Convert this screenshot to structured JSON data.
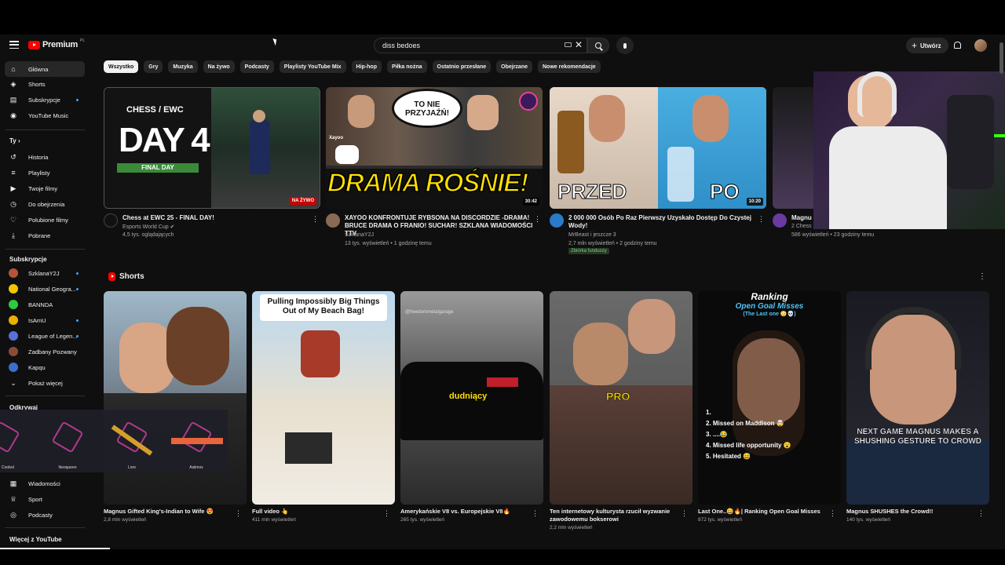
{
  "header": {
    "logo": "Premium",
    "logo_region": "PL",
    "search_value": "diss bedoes",
    "create_label": "Utwórz"
  },
  "sidebar": {
    "main": [
      "Główna",
      "Shorts",
      "Subskrypcje",
      "YouTube Music"
    ],
    "you_heading": "Ty",
    "you_items": [
      "Historia",
      "Playlisty",
      "Twoje filmy",
      "Do obejrzenia",
      "Polubione filmy",
      "Pobrane"
    ],
    "subs_heading": "Subskrypcje",
    "subs": [
      "SzklanaY2J",
      "National Geogra...",
      "BANNDA",
      "IsAmU",
      "League of Legen...",
      "Zadbany Pozwany",
      "Kapqu"
    ],
    "show_more": "Pokaż więcej",
    "explore_heading": "Odkrywaj",
    "explore_items": [
      "Wiadomości",
      "Sport",
      "Podcasty"
    ],
    "more_heading": "Więcej z YouTube"
  },
  "chips": [
    "Wszystko",
    "Gry",
    "Muzyka",
    "Na żywo",
    "Podcasty",
    "Playlisty YouTube Mix",
    "Hip-hop",
    "Piłka nożna",
    "Ostatnio przesłane",
    "Obejrzane",
    "Nowe rekomendacje"
  ],
  "videos": [
    {
      "title": "Chess at EWC 25 - FINAL DAY!",
      "title2": "",
      "channel": "Esports World Cup ✔",
      "stats": "4,5 tys. oglądających",
      "badge": "NA ŻYWO",
      "thumb_text1": "CHESS / EWC",
      "thumb_text2": "DAY 4",
      "thumb_text3": "FINAL DAY"
    },
    {
      "title": "XAYOO KONFRONTUJE RYBSONA NA DISCORDZIE -DRAMA!",
      "title2": "BRUCE DRAMA O FRANIO! SUCHAR! SZKLANA WIADOMOŚCI TTV",
      "channel": "SzklanaY2J",
      "stats": "13 tys. wyświetleń • 1 godzinę temu",
      "badge": "30:42",
      "thumb_text1": "TO NIE PRZYJAŹŃ!",
      "thumb_text2": "DRAMA ROŚNIE!",
      "thumb_text3": "Xayoo"
    },
    {
      "title": "2 000 000 Osób Po Raz Pierwszy Uzyskało Dostęp Do Czystej",
      "title2": "Wody!",
      "channel": "MrBeast i jeszcze 3",
      "stats": "2,7 mln wyświetleń • 2 godziny temu",
      "badge": "10:20",
      "funded": "Zbiórka funduszy",
      "thumb_text1": "PRZED",
      "thumb_text2": "PO"
    },
    {
      "title": "Magnu",
      "channel": "2 Chess",
      "stats": "586 wyświetleń • 23 godziny temu"
    }
  ],
  "shorts": {
    "heading": "Shorts",
    "items": [
      {
        "title": "Magnus Gifted King's-Indian to Wife 😍",
        "title2": "",
        "stats": "2,8 mln wyświetleń"
      },
      {
        "title": "Full video 👆",
        "title2": "",
        "stats": "411 mln wyświetleń",
        "thumb_text": "Pulling Impossibly Big Things Out of My Beach Bag!"
      },
      {
        "title": "Amerykańskie V8 vs. Europejskie V8🔥",
        "title2": "",
        "stats": "265 tys. wyświetleń",
        "thumb_text": "dudniący",
        "watermark": "@freedommetalgarage"
      },
      {
        "title": "Ten internetowy kulturysta rzucił wyzwanie",
        "title2": "zawodowemu bokserowi",
        "stats": "2,2 mln wyświetleń",
        "thumb_text": "PRO"
      },
      {
        "title": "Last One..😄🔥| Ranking Open Goal Misses",
        "title2": "",
        "stats": "872 tys. wyświetleń",
        "thumb_title": "Ranking",
        "thumb_sub": "Open Goal Misses",
        "thumb_sub2": "(The Last one 😳💀)",
        "list": [
          "1.",
          "2. Missed on Maddison 🤯",
          "3. ....😂",
          "4. Missed life opportunity 😮",
          "5. Hesitated 😅"
        ]
      },
      {
        "title": "Magnus SHUSHES the Crowd!!",
        "title2": "",
        "stats": "140 tys. wyświetleń",
        "thumb_text": "NEXT GAME MAGNUS MAKES A SHUSHING GESTURE TO CROWD"
      }
    ]
  },
  "overlay_skins": [
    "Cooled",
    "Neoqueen",
    "Lore",
    "Asiimov"
  ],
  "colors": {
    "bg": "#0f0f0f",
    "accent": "#ff0000",
    "chip": "#272727",
    "link": "#3ea6ff"
  }
}
